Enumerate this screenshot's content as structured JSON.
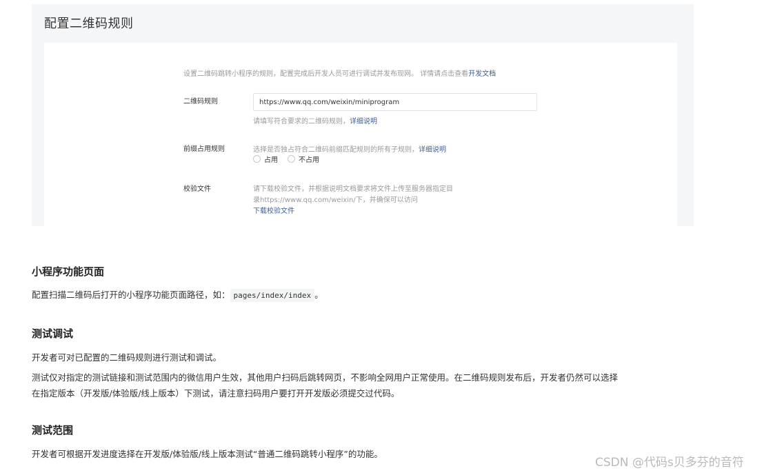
{
  "panel": {
    "title": "配置二维码规则",
    "intro": "设置二维码跳转小程序的规则，配置完成后开发人员可进行调试并发布现网。 详情请点击查看",
    "intro_link": "开发文档",
    "qr_rule": {
      "label": "二维码规则",
      "value": "https://www.qq.com/weixin/miniprogram",
      "hint": "请填写符合要求的二维码规则，",
      "hint_link": "详细说明"
    },
    "prefix": {
      "label": "前缀占用规则",
      "hint": "选择是否独占符合二维码前缀匹配规则的所有子规则，",
      "hint_link": "详细说明",
      "options": [
        "占用",
        "不占用"
      ]
    },
    "verify": {
      "label": "校验文件",
      "line1": "请下载校验文件，并根据说明文档要求将文件上传至服务器指定目",
      "line2": "录https://www.qq.com/weixin/下，并确保可以访问",
      "download": "下载校验文件"
    }
  },
  "article": {
    "s1_title": "小程序功能页面",
    "s1_text_pre": "配置扫描二维码后打开的小程序功能页面路径，如：",
    "s1_code": "pages/index/index",
    "s1_text_post": "。",
    "s2_title": "测试调试",
    "s2_p1": "开发者可对已配置的二维码规则进行测试和调试。",
    "s2_p2a": "测试仅对指定的测试链接和测试范围内的微信用户生效，其他用户扫码后跳转网页，不影响全网用户正常使用。在二维码规则发布后，开发者仍然可以选择",
    "s2_p2b": "在指定版本（开发版/体验版/线上版本）下测试，请注意扫码用户要打开开发版必须提交过代码。",
    "s3_title": "测试范围",
    "s3_p1": "开发者可根据开发进度选择在开发版/体验版/线上版本测试“普通二维码跳转小程序”的功能。"
  },
  "watermark": "CSDN @代码s贝多芬的音符"
}
